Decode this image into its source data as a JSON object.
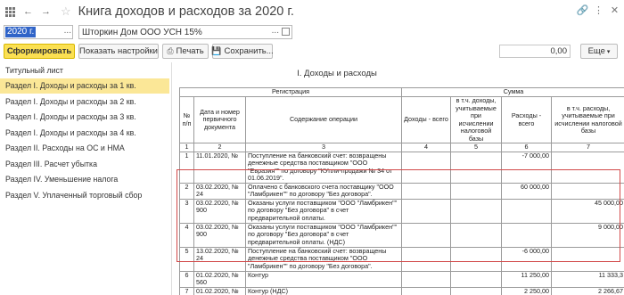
{
  "window": {
    "title": "Книга доходов и расходов за 2020 г.",
    "icons": [
      "grid-icon",
      "back-arrow-icon",
      "forward-arrow-icon",
      "star-icon",
      "link-icon",
      "kebab-menu-icon",
      "close-icon"
    ]
  },
  "selectors": {
    "year_value": "2020 г.",
    "year_more": "...",
    "organization_value": "Шторкин Дом ООО УСН 15%",
    "organization_more": "..."
  },
  "toolbar": {
    "form_label": "Сформировать",
    "settings_label": "Показать настройки",
    "print_label": "Печать",
    "save_label": "Сохранить...",
    "sum_value": "0,00",
    "more_label": "Еще"
  },
  "sidebar": {
    "items": [
      {
        "label": "Титульный лист",
        "active": false
      },
      {
        "label": "Раздел I. Доходы и расходы за 1 кв.",
        "active": true
      },
      {
        "label": "Раздел I. Доходы и расходы за 2 кв.",
        "active": false
      },
      {
        "label": "Раздел I. Доходы и расходы за 3 кв.",
        "active": false
      },
      {
        "label": "Раздел I. Доходы и расходы за 4 кв.",
        "active": false
      },
      {
        "label": "Раздел II. Расходы на ОС и НМА",
        "active": false
      },
      {
        "label": "Раздел III. Расчет убытка",
        "active": false
      },
      {
        "label": "Раздел IV. Уменьшение налога",
        "active": false
      },
      {
        "label": "Раздел V. Уплаченный торговый сбор",
        "active": false
      }
    ]
  },
  "report": {
    "title": "I. Доходы и расходы",
    "headers": {
      "registration": "Регистрация",
      "sum": "Сумма",
      "num": "№ п/п",
      "date_doc": "Дата и номер первичного документа",
      "content": "Содержание операции",
      "income_total": "Доходы - всего",
      "income_tax": "в т.ч. доходы, учитываемые при исчислении налоговой базы",
      "expense_total": "Расходы - всего",
      "expense_tax": "в т.ч. расходы, учитываемые при исчислении налоговой базы"
    },
    "col_numbers": [
      "1",
      "2",
      "3",
      "4",
      "5",
      "6",
      "7"
    ],
    "rows": [
      {
        "n": "1",
        "date": "11.01.2020, №",
        "content": "Поступление на банковский счет: возвращены денежные средства поставщиком \"ООО \"Евразия\"\" по договору \"КУпли-продажи № 34 от 01.06.2019\".",
        "income_total": "",
        "income_tax": "",
        "expense_total": "-7 000,00",
        "expense_tax": ""
      },
      {
        "n": "2",
        "date": "03.02.2020, № 24",
        "content": "Оплачено с банковского счета поставщику \"ООО \"Ламбрикен\"\" по договору \"Без договора\".",
        "income_total": "",
        "income_tax": "",
        "expense_total": "60 000,00",
        "expense_tax": ""
      },
      {
        "n": "3",
        "date": "03.02.2020, № 900",
        "content": "Оказаны услуги поставщиком \"ООО \"Ламбрикен\"\" по договору \"Без договора\" в счет предварительной оплаты.",
        "income_total": "",
        "income_tax": "",
        "expense_total": "",
        "expense_tax": "45 000,00"
      },
      {
        "n": "4",
        "date": "03.02.2020, № 900",
        "content": "Оказаны услуги поставщиком \"ООО \"Ламбрикен\"\" по договору \"Без договора\" в счет предварительной оплаты.  (НДС)",
        "income_total": "",
        "income_tax": "",
        "expense_total": "",
        "expense_tax": "9 000,00"
      },
      {
        "n": "5",
        "date": "13.02.2020, № 24",
        "content": "Поступление на банковский счет: возвращены денежные средства поставщиком \"ООО \"Ламбрикен\"\" по договору \"Без договора\".",
        "income_total": "",
        "income_tax": "",
        "expense_total": "-6 000,00",
        "expense_tax": ""
      },
      {
        "n": "6",
        "date": "01.02.2020, № 560",
        "content": "Контур",
        "income_total": "",
        "income_tax": "",
        "expense_total": "11 250,00",
        "expense_tax": "11 333,3"
      },
      {
        "n": "7",
        "date": "01.02.2020, № 560",
        "content": "Контур  (НДС)",
        "income_total": "",
        "income_tax": "",
        "expense_total": "2 250,00",
        "expense_tax": "2 266,67"
      }
    ]
  }
}
